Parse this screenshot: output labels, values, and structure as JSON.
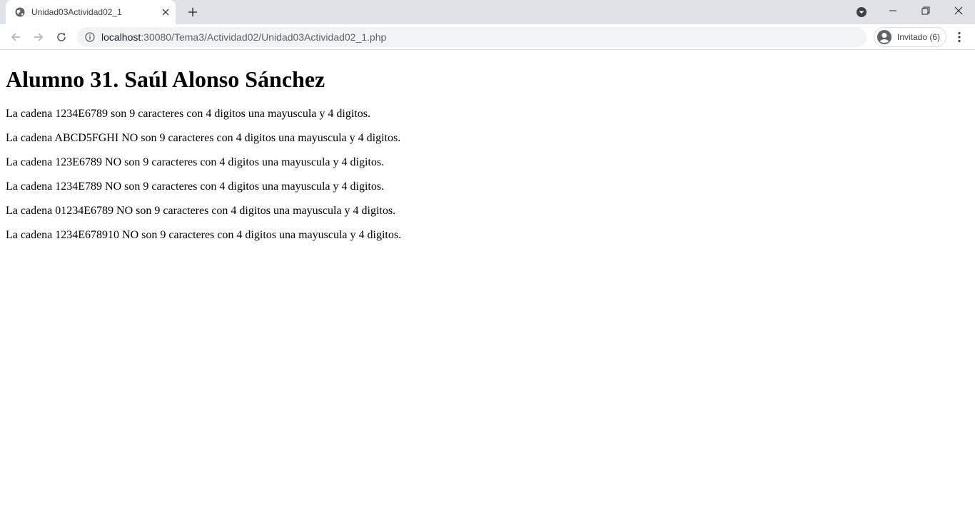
{
  "browser": {
    "tab": {
      "title": "Unidad03Actividad02_1"
    },
    "omnibox": {
      "host": "localhost",
      "path": ":30080/Tema3/Actividad02/Unidad03Actividad02_1.php"
    },
    "profile": {
      "label": "Invitado (6)"
    },
    "icons": {
      "favicon": "globe-icon",
      "close": "close-icon",
      "new_tab": "plus-icon",
      "back": "arrow-left-icon",
      "forward": "arrow-right-icon",
      "reload": "reload-icon",
      "info": "info-icon",
      "avatar": "person-icon",
      "menu": "kebab-menu-icon",
      "minimize": "minimize-icon",
      "restore": "restore-icon",
      "window_close": "window-close-icon"
    }
  },
  "page": {
    "heading": "Alumno 31. Saúl Alonso Sánchez",
    "lines": [
      "La cadena 1234E6789 son 9 caracteres con 4 digitos una mayuscula y 4 digitos.",
      "La cadena ABCD5FGHI NO son 9 caracteres con 4 digitos una mayuscula y 4 digitos.",
      "La cadena 123E6789 NO son 9 caracteres con 4 digitos una mayuscula y 4 digitos.",
      "La cadena 1234E789 NO son 9 caracteres con 4 digitos una mayuscula y 4 digitos.",
      "La cadena 01234E6789 NO son 9 caracteres con 4 digitos una mayuscula y 4 digitos.",
      "La cadena 1234E678910 NO son 9 caracteres con 4 digitos una mayuscula y 4 digitos."
    ]
  }
}
